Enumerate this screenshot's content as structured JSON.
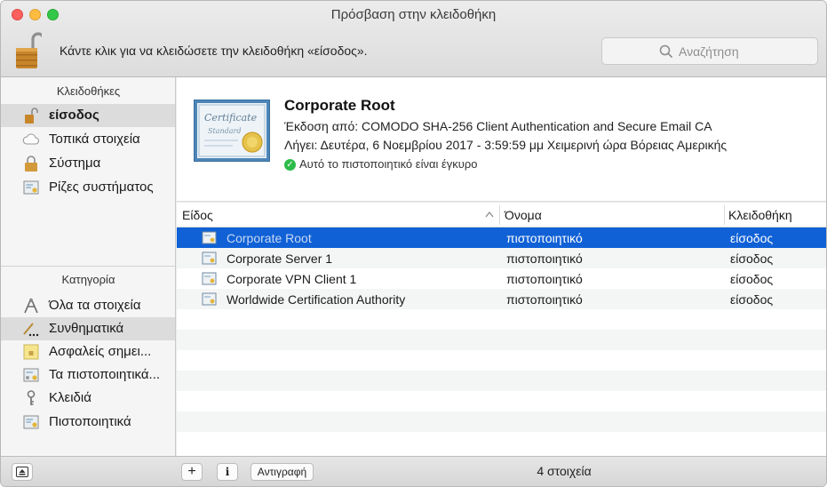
{
  "window": {
    "title": "Πρόσβαση στην κλειδοθήκη"
  },
  "toolbar": {
    "lock_message": "Κάντε κλικ για να κλειδώσετε την κλειδοθήκη «είσοδος».",
    "search_placeholder": "Αναζήτηση"
  },
  "sidebar": {
    "keychains_header": "Κλειδοθήκες",
    "keychains": [
      {
        "label": "είσοδος",
        "icon": "open-padlock-icon",
        "selected": true
      },
      {
        "label": "Τοπικά στοιχεία",
        "icon": "cloud-icon"
      },
      {
        "label": "Σύστημα",
        "icon": "padlock-icon"
      },
      {
        "label": "Ρίζες συστήματος",
        "icon": "certificate-icon"
      }
    ],
    "category_header": "Κατηγορία",
    "categories": [
      {
        "label": "Όλα τα στοιχεία",
        "icon": "all-items-icon"
      },
      {
        "label": "Συνθηματικά",
        "icon": "password-icon",
        "selected": true
      },
      {
        "label": "Ασφαλείς σημει...",
        "icon": "secure-note-icon"
      },
      {
        "label": "Τα πιστοποιητικά...",
        "icon": "my-certificate-icon"
      },
      {
        "label": "Κλειδιά",
        "icon": "key-icon"
      },
      {
        "label": "Πιστοποιητικά",
        "icon": "certificate-icon"
      }
    ]
  },
  "detail": {
    "name": "Corporate Root",
    "issuer": "Έκδοση από: COMODO SHA-256 Client Authentication and Secure Email CA",
    "expires": "Λήγει: Δευτέρα, 6 Νοεμβρίου 2017 - 3:59:59 μμ Χειμερινή ώρα Βόρειας Αμερικής",
    "status": "Αυτό το πιστοποιητικό είναι έγκυρο",
    "badge_word1": "Certificate",
    "badge_word2": "Standard"
  },
  "table": {
    "columns": [
      "Είδος",
      "Όνομα",
      "Κλειδοθήκη"
    ],
    "rows": [
      {
        "name": "Corporate Root",
        "kind": "πιστοποιητικό",
        "keychain": "είσοδος",
        "selected": true
      },
      {
        "name": "Corporate Server 1",
        "kind": "πιστοποιητικό",
        "keychain": "είσοδος"
      },
      {
        "name": "Corporate VPN Client 1",
        "kind": "πιστοποιητικό",
        "keychain": "είσοδος"
      },
      {
        "name": "Worldwide Certification Authority",
        "kind": "πιστοποιητικό",
        "keychain": "είσοδος"
      }
    ]
  },
  "bottom": {
    "add_label": "+",
    "info_label": "i",
    "copy_label": "Αντιγραφή",
    "status": "4 στοιχεία"
  },
  "colors": {
    "selection": "#1061d6",
    "valid": "#2dbb4a"
  }
}
